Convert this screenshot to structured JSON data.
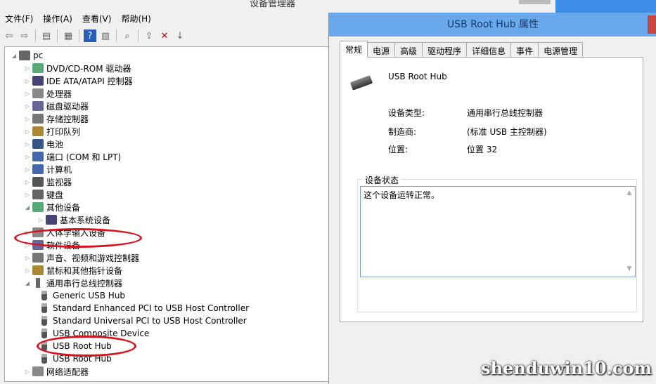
{
  "window": {
    "title": "设备管理器"
  },
  "menu": [
    "文件(F)",
    "操作(A)",
    "查看(V)",
    "帮助(H)"
  ],
  "toolbar": [
    "back-icon",
    "forward-icon",
    "show-hide-tree-icon",
    "properties-icon",
    "help-icon",
    "action-pane-icon",
    "scan-hardware-icon",
    "update-driver-icon",
    "disable-device-icon",
    "uninstall-device-icon"
  ],
  "tree": [
    {
      "label": "pc",
      "level": 0,
      "expanded": true
    },
    {
      "label": "DVD/CD-ROM 驱动器",
      "level": 1
    },
    {
      "label": "IDE ATA/ATAPI 控制器",
      "level": 1
    },
    {
      "label": "处理器",
      "level": 1
    },
    {
      "label": "磁盘驱动器",
      "level": 1
    },
    {
      "label": "存储控制器",
      "level": 1
    },
    {
      "label": "打印队列",
      "level": 1
    },
    {
      "label": "电池",
      "level": 1
    },
    {
      "label": "端口 (COM 和 LPT)",
      "level": 1
    },
    {
      "label": "计算机",
      "level": 1
    },
    {
      "label": "监视器",
      "level": 1
    },
    {
      "label": "键盘",
      "level": 1
    },
    {
      "label": "其他设备",
      "level": 1,
      "expanded": true
    },
    {
      "label": "基本系统设备",
      "level": 2
    },
    {
      "label": "人体学输入设备",
      "level": 1
    },
    {
      "label": "软件设备",
      "level": 1
    },
    {
      "label": "声音、视频和游戏控制器",
      "level": 1
    },
    {
      "label": "鼠标和其他指针设备",
      "level": 1
    },
    {
      "label": "通用串行总线控制器",
      "level": 1,
      "expanded": true,
      "highlighted": true
    },
    {
      "label": "Generic USB Hub",
      "level": 2,
      "usb": true
    },
    {
      "label": "Standard Enhanced PCI to USB Host Controller",
      "level": 2,
      "usb": true
    },
    {
      "label": "Standard Universal PCI to USB Host Controller",
      "level": 2,
      "usb": true
    },
    {
      "label": "USB Composite Device",
      "level": 2,
      "usb": true
    },
    {
      "label": "USB Root Hub",
      "level": 2,
      "usb": true,
      "highlighted": true
    },
    {
      "label": "USB Root Hub",
      "level": 2,
      "usb": true
    },
    {
      "label": "网络适配器",
      "level": 1
    }
  ],
  "dialog": {
    "title": "USB Root Hub 属性",
    "tabs": [
      "常规",
      "电源",
      "高级",
      "驱动程序",
      "详细信息",
      "事件",
      "电源管理"
    ],
    "device_name": "USB Root Hub",
    "fields": [
      {
        "label": "设备类型:",
        "value": "通用串行总线控制器"
      },
      {
        "label": "制造商:",
        "value": "(标准 USB 主控制器)"
      },
      {
        "label": "位置:",
        "value": "位置 32"
      }
    ],
    "status_group": "设备状态",
    "status_text": "这个设备运转正常。"
  },
  "watermark": "shenduwin10.com",
  "colors": {
    "title_bar": "#6aa8ec",
    "highlight_ellipse": "#d8131b"
  }
}
